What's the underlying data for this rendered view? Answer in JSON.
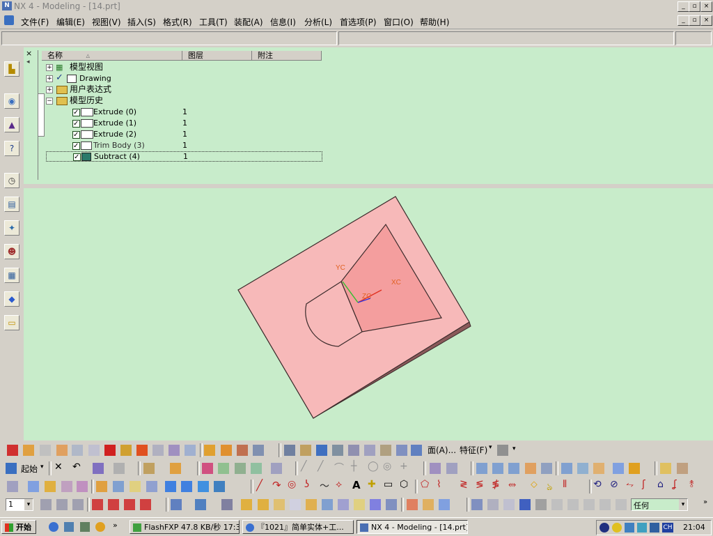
{
  "window": {
    "title": "NX 4 - Modeling - [14.prt]"
  },
  "menus": [
    "文件(F)",
    "编辑(E)",
    "视图(V)",
    "插入(S)",
    "格式(R)",
    "工具(T)",
    "装配(A)",
    "信息(I)",
    "分析(L)",
    "首选项(P)",
    "窗口(O)",
    "帮助(H)"
  ],
  "navigator": {
    "columns": [
      "名称",
      "图层",
      "附注"
    ],
    "nodes": [
      {
        "label": "模型视图",
        "layer": ""
      },
      {
        "label": "Drawing",
        "layer": ""
      },
      {
        "label": "用户表达式",
        "layer": ""
      },
      {
        "label": "模型历史",
        "layer": ""
      },
      {
        "label": "Extrude (0)",
        "layer": "1"
      },
      {
        "label": "Extrude (1)",
        "layer": "1"
      },
      {
        "label": "Extrude (2)",
        "layer": "1"
      },
      {
        "label": "Trim Body (3)",
        "layer": "1"
      },
      {
        "label": "Subtract (4)",
        "layer": "1"
      }
    ]
  },
  "graphics": {
    "axis_labels": {
      "yc": "YC",
      "xc": "XC",
      "zc": "ZC"
    }
  },
  "toolbars": {
    "face_label": "面(A)...",
    "feature_label": "特征(F)",
    "start_label": "起始",
    "layer_value": "1",
    "filter_value": "任何"
  },
  "taskbar": {
    "start": "开始",
    "tasks": [
      "FlashFXP 47.8 KB/秒 17:3...",
      "『1021』简单实体+工...",
      "NX 4 - Modeling - [14.prt]"
    ],
    "lang": "CH",
    "clock": "21:04"
  },
  "colors": {
    "background": "#c8ecca",
    "solid_top": "#f7b9b9",
    "solid_side": "#6e4646",
    "edge": "#3a2a2a"
  }
}
